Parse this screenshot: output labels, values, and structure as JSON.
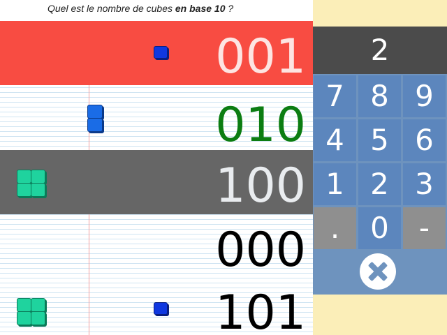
{
  "question": {
    "prefix": "Quel est le nombre de cubes ",
    "emphasis": "en base 10",
    "suffix": " ?"
  },
  "rows": [
    {
      "value": "001",
      "color": "#ffffff",
      "background": "#f84c42"
    },
    {
      "value": "010",
      "color": "#0c7d12",
      "background": ""
    },
    {
      "value": "100",
      "color": "#e9ecef",
      "background": "#666666"
    },
    {
      "value": "000",
      "color": "#000000",
      "background": ""
    },
    {
      "value": "101",
      "color": "#000000",
      "background": ""
    }
  ],
  "display": {
    "value": "2"
  },
  "keys": [
    "7",
    "8",
    "9",
    "4",
    "5",
    "6",
    "1",
    "2",
    "3",
    ".",
    "0",
    "-"
  ],
  "clear": {
    "icon": "close-circle-icon"
  },
  "colors": {
    "highlight_red": "#f84c42",
    "highlight_gray": "#666666",
    "keypad_blue": "#6e93be",
    "display_bg": "#4b4b4b",
    "cube_blue": "#1038e0",
    "cube_green": "#1fd39e",
    "right_panel_bg": "#fbeeb8"
  }
}
